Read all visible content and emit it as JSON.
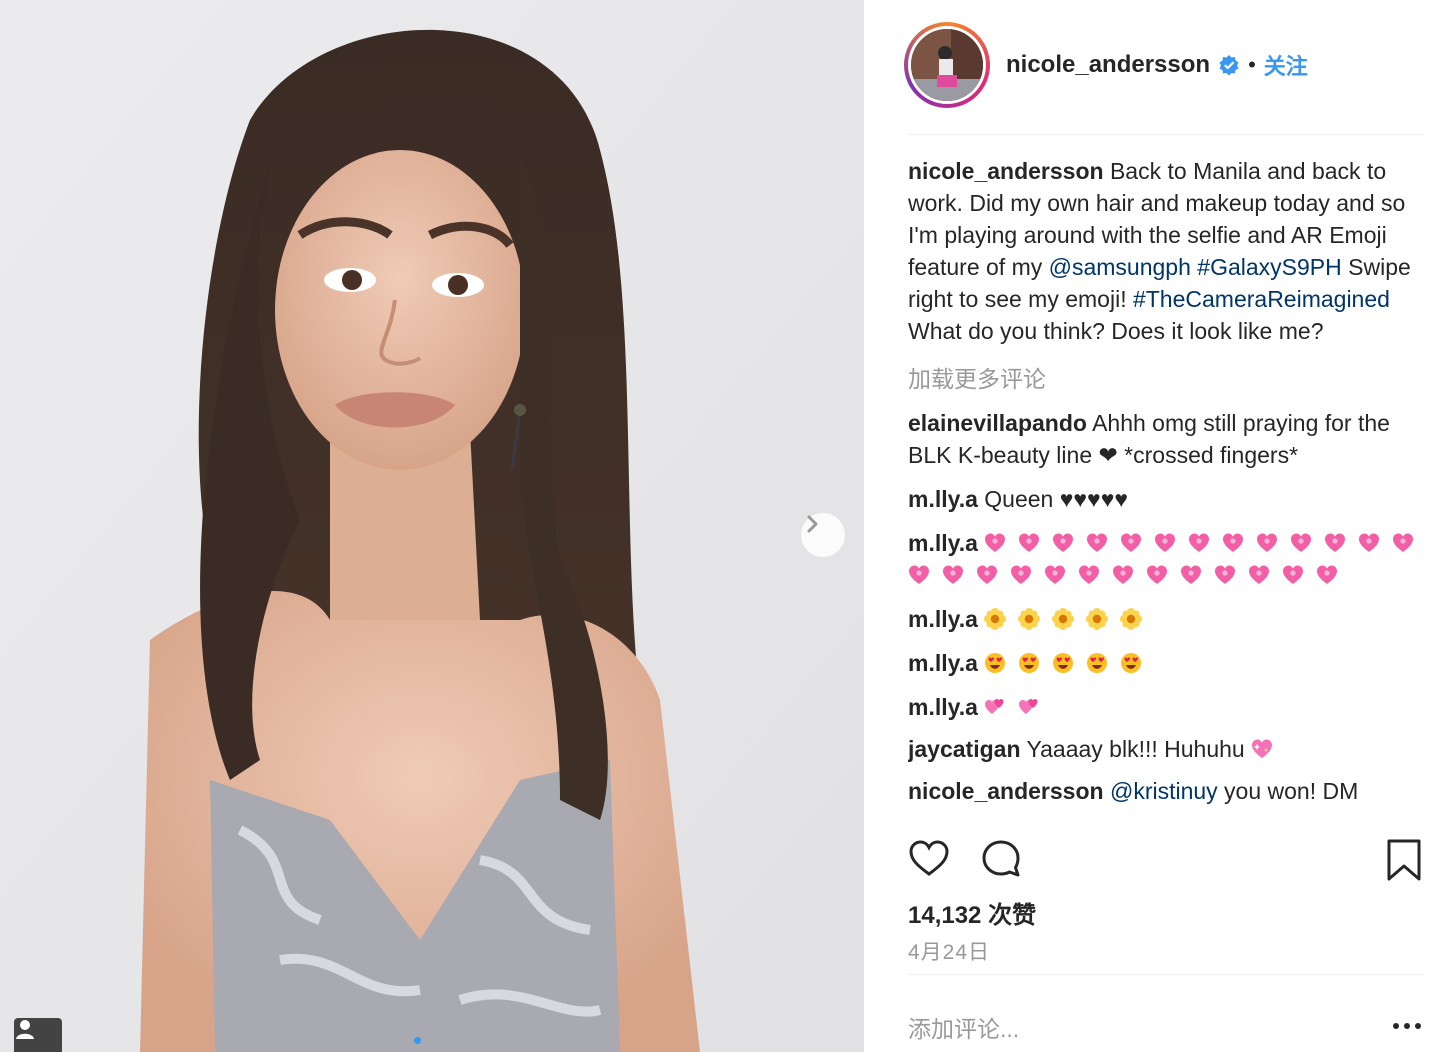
{
  "post": {
    "username": "nicole_andersson",
    "separator": "•",
    "follow_label": "关注",
    "caption": {
      "username": "nicole_andersson",
      "text_1": " Back to Manila and back to work. Did my own hair and makeup today and so I'm playing around with the selfie and AR Emoji feature of my ",
      "mention": "@samsungph",
      "space_1": " ",
      "hashtag_1": "#GalaxyS9PH",
      "text_2": " Swipe right to see my emoji! ",
      "hashtag_2": "#TheCameraReimagined",
      "text_3": " What do you think? Does it look like me?"
    },
    "load_more": "加载更多评论",
    "comments": [
      {
        "user": "elainevillapando",
        "text": " Ahhh omg still praying for the BLK K-beauty line ❤ *crossed fingers*"
      },
      {
        "user": "m.lly.a",
        "text": " Queen ♥♥♥♥♥"
      },
      {
        "user": "m.lly.a",
        "emoji": "pink-heart",
        "count": 26
      },
      {
        "user": "m.lly.a",
        "emoji": "flower",
        "count": 5
      },
      {
        "user": "m.lly.a",
        "emoji": "heart-eyes",
        "count": 5
      },
      {
        "user": "m.lly.a",
        "emoji": "two-hearts",
        "count": 2
      },
      {
        "user": "jaycatigan",
        "text": " Yaaaay blk!!! Huhuhu ",
        "emoji": "sparkle-heart",
        "count": 1
      },
      {
        "user": "nicole_andersson",
        "mention": "@kristinuy",
        "text": " you won! DM"
      }
    ],
    "likes": "14,132 次赞",
    "date": "4月24日",
    "add_comment_placeholder": "添加评论...",
    "more_label": "...",
    "carousel": {
      "slides": 2,
      "active": 0
    }
  },
  "colors": {
    "link": "#003569",
    "accent": "#3897f0",
    "muted": "#999999",
    "text": "#262626"
  },
  "icons": [
    "chevron-right-icon",
    "person-tag-icon",
    "verified-badge-icon",
    "heart-icon",
    "comment-bubble-icon",
    "bookmark-icon",
    "more-dots-icon"
  ]
}
